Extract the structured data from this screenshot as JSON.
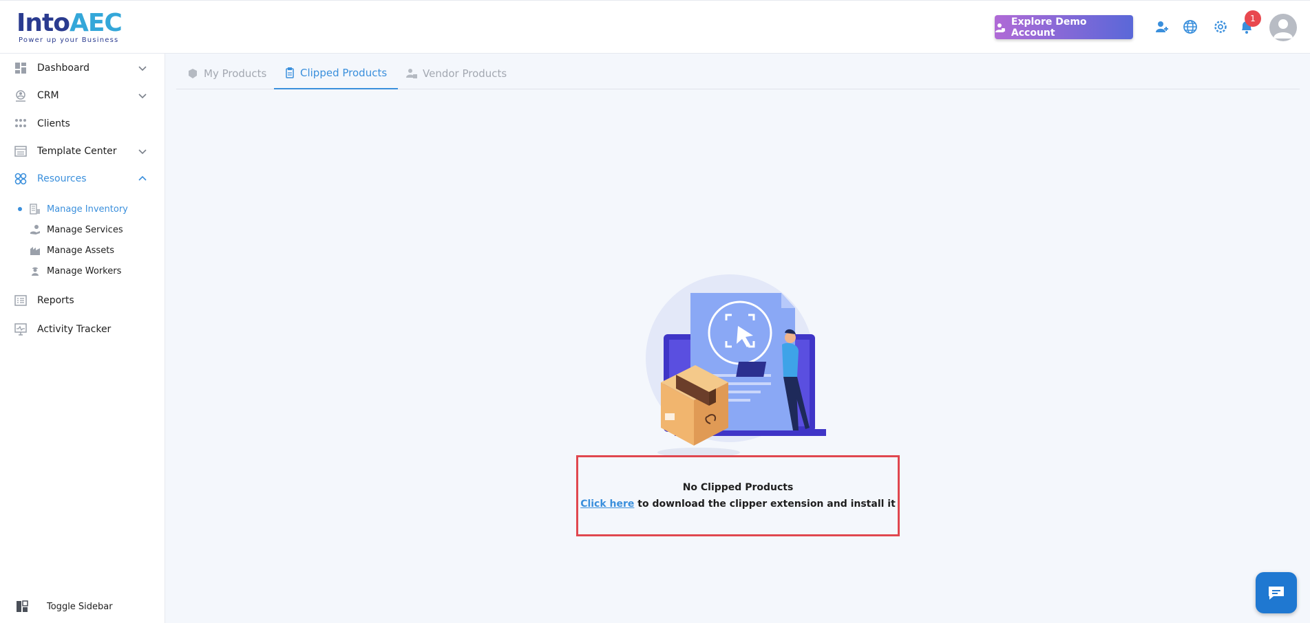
{
  "brand": {
    "name_part1": "Into",
    "name_part2": "AEC",
    "tagline": "Power up your Business"
  },
  "header": {
    "demo_button": "Explore Demo Account",
    "notification_count": "1",
    "icons": [
      "add-user-icon",
      "globe-icon",
      "gear-icon",
      "bell-icon",
      "avatar-icon"
    ]
  },
  "sidebar": {
    "items": [
      {
        "label": "Dashboard",
        "icon": "dashboard-icon",
        "chevron": "down"
      },
      {
        "label": "CRM",
        "icon": "crm-icon",
        "chevron": "down"
      },
      {
        "label": "Clients",
        "icon": "clients-icon"
      },
      {
        "label": "Template Center",
        "icon": "template-icon",
        "chevron": "down"
      },
      {
        "label": "Resources",
        "icon": "resources-icon",
        "chevron": "up",
        "active": true
      }
    ],
    "sub_items": [
      {
        "label": "Manage Inventory",
        "icon": "inventory-icon",
        "active": true
      },
      {
        "label": "Manage Services",
        "icon": "services-icon"
      },
      {
        "label": "Manage Assets",
        "icon": "assets-icon"
      },
      {
        "label": "Manage Workers",
        "icon": "workers-icon"
      }
    ],
    "bottom_items": [
      {
        "label": "Reports",
        "icon": "reports-icon"
      },
      {
        "label": "Activity Tracker",
        "icon": "activity-icon"
      }
    ],
    "toggle_label": "Toggle Sidebar"
  },
  "tabs": [
    {
      "label": "My Products",
      "icon": "products-icon",
      "active": false
    },
    {
      "label": "Clipped Products",
      "icon": "clip-icon",
      "active": true
    },
    {
      "label": "Vendor Products",
      "icon": "vendor-icon",
      "active": false
    }
  ],
  "empty_state": {
    "title": "No Clipped Products",
    "link_text": "Click here",
    "message": " to download the clipper extension and install it"
  },
  "colors": {
    "accent": "#3a8fdc",
    "highlight_border": "#e0474f",
    "brand_dark": "#2a3b8f"
  }
}
